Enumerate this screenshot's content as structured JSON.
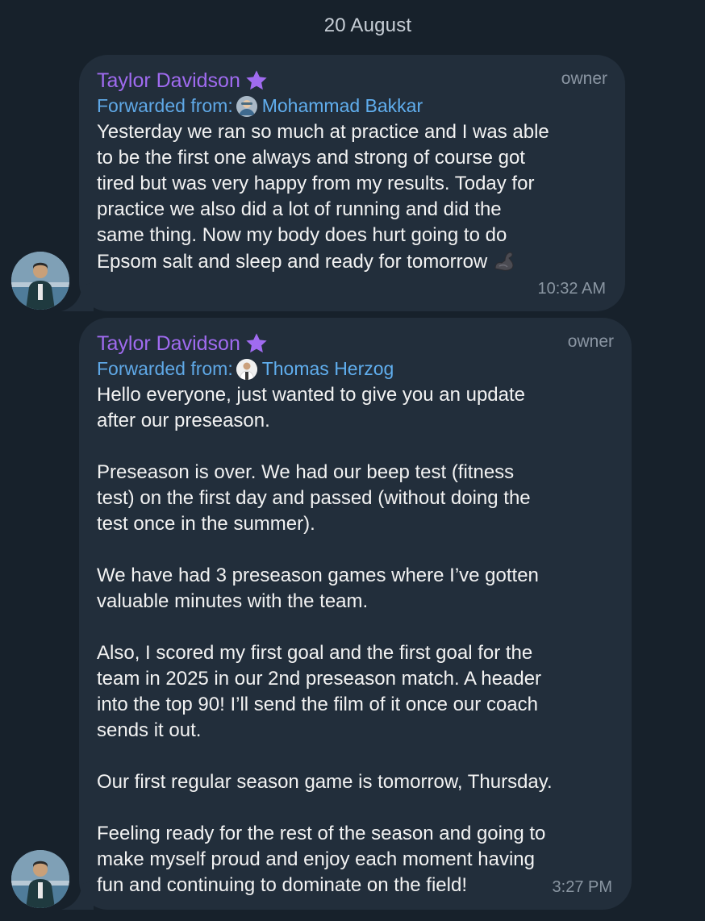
{
  "chat": {
    "date_label": "20 August",
    "messages": [
      {
        "sender": "Taylor Davidson",
        "role": "owner",
        "forwarded_prefix": "Forwarded from:",
        "forwarded_name": "Mohammad Bakkar",
        "text": "Yesterday we ran so much at practice and I was able\nto be the first one always and strong of course got\ntired but was very happy from my results. Today for\npractice we also did a lot of running and did the\nsame thing. Now my body does hurt going to do\nEpsom salt and sleep and ready for tomorrow",
        "emoji": "flexed-biceps",
        "time": "10:32 AM"
      },
      {
        "sender": "Taylor Davidson",
        "role": "owner",
        "forwarded_prefix": "Forwarded from:",
        "forwarded_name": "Thomas Herzog",
        "text": "Hello everyone, just wanted to give you an update\nafter our preseason.\n\nPreseason is over. We had our beep test (fitness\ntest) on the first day and passed (without doing the\ntest once in the summer).\n\nWe have had 3 preseason games where I’ve gotten\nvaluable minutes with the team.\n\nAlso, I scored my first goal and the first goal for the\nteam in 2025 in our 2nd preseason match. A header\ninto the top 90! I’ll send the film of it once our coach\nsends it out.\n\nOur first regular season game is tomorrow, Thursday.\n\nFeeling ready for the rest of the season and going to\nmake myself proud and enjoy each moment having\nfun and continuing to dominate on the field!",
        "time": "3:27 PM"
      }
    ]
  },
  "colors": {
    "background": "#17212b",
    "bubble": "#222e3b",
    "sender_name": "#a06bf0",
    "forward_link": "#60aeee",
    "meta_text": "#8a96a2"
  }
}
